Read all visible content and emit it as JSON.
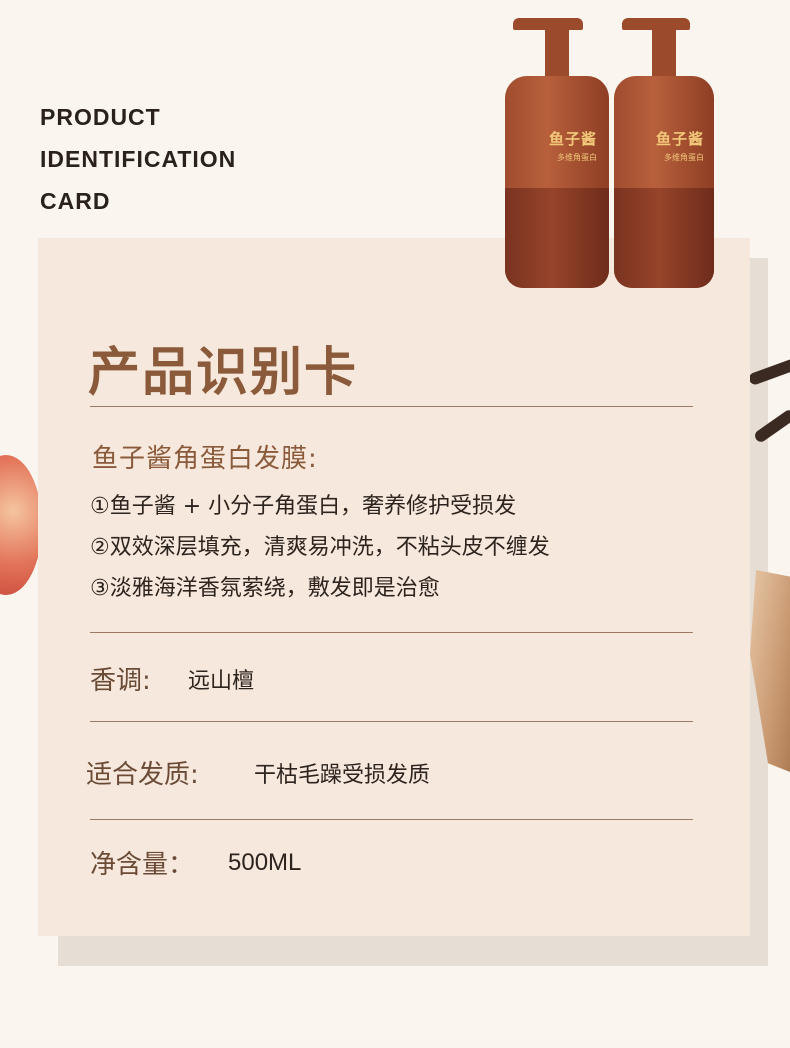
{
  "header": {
    "en_title_lines": [
      "PRODUCT",
      "IDENTIFICATION",
      "CARD"
    ]
  },
  "product_image": {
    "label_main": "鱼子酱",
    "label_sub": "多维角蛋白"
  },
  "card": {
    "title": "产品识别卡",
    "subtitle": "鱼子酱角蛋白发膜:",
    "features": [
      "①鱼子酱 + 小分子角蛋白，奢养修护受损发",
      "②双效深层填充，清爽易冲洗，不粘头皮不缠发",
      "③淡雅海洋香氛萦绕，敷发即是治愈"
    ],
    "specs": [
      {
        "label": "香调:",
        "value": "远山檀"
      },
      {
        "label": "适合发质:",
        "value": "干枯毛躁受损发质"
      },
      {
        "label": "净含量：",
        "value": "500ML"
      }
    ]
  },
  "colors": {
    "background": "#faf5ef",
    "card": "#f6e8dc",
    "accent": "#8a5a3a",
    "bottle": "#a04c2e"
  }
}
